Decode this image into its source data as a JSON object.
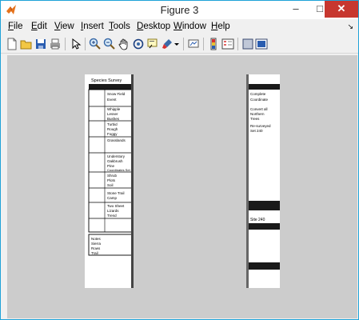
{
  "window": {
    "title": "Figure 3"
  },
  "menu": {
    "items": [
      "File",
      "Edit",
      "View",
      "Insert",
      "Tools",
      "Desktop",
      "Window",
      "Help"
    ]
  },
  "toolbar": {
    "tools": [
      "new-figure-icon",
      "open-file-icon",
      "save-icon",
      "print-icon",
      "pointer-icon",
      "zoom-in-icon",
      "zoom-out-icon",
      "pan-icon",
      "rotate-3d-icon",
      "data-cursor-icon",
      "brush-icon",
      "brush-dropdown-icon",
      "link-plot-icon",
      "insert-colorbar-icon",
      "insert-legend-icon",
      "hide-plot-tools-icon",
      "show-plot-tools-icon"
    ]
  },
  "left_image": {
    "lines": [
      "Species Survey",
      "Snow Field",
      "Event",
      "Whipple",
      "Lesser",
      "Bushes",
      "Turbid",
      "Rough",
      "Foggy",
      "Grasslands",
      "Understory",
      "Oakbrush",
      "Pine",
      "Coordinates Set",
      "Shrub",
      "Plots",
      "Soil",
      "Stone Trail",
      "Camp",
      "Two Sheet",
      "Lizards",
      "Trend",
      "Notes",
      "Sierra",
      "Rows",
      "Trail"
    ]
  },
  "right_image": {
    "lines": [
      "Complete",
      "Coordinate",
      "Convert all",
      "Northern",
      "Trees",
      "Re-surveyed",
      "Set 240",
      "Site 240"
    ]
  }
}
